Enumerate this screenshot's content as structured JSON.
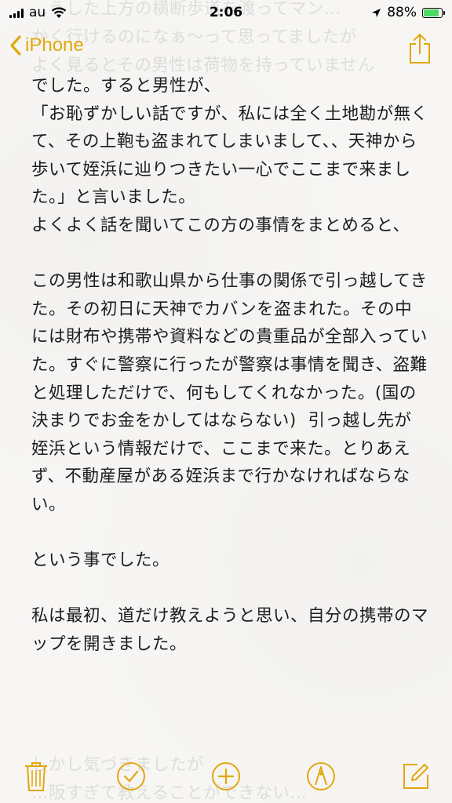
{
  "status_bar": {
    "carrier": "au",
    "time": "2:06",
    "battery_percent": "88%",
    "battery_level": 0.88
  },
  "nav": {
    "back_label": "iPhone"
  },
  "note": {
    "faded_top_1": "…うした上方の横断歩道を渡ってマン…",
    "faded_top_2": "かく行けるのになぁ〜って思ってましたが",
    "faded_top_3": "よく見るとその男性は荷物を持っていません",
    "body": "でした。すると男性が、\n「お恥ずかしい話ですが、私には全く土地勘が無くて、その上鞄も盗まれてしまいまして、、天神から歩いて姪浜に辿りつきたい一心でここまで来ました。」と言いました。\nよくよく話を聞いてこの方の事情をまとめると、\n\nこの男性は和歌山県から仕事の関係で引っ越してきた。その初日に天神でカバンを盗まれた。その中には財布や携帯や資料などの貴重品が全部入っていた。すぐに警察に行ったが警察は事情を聞き、盗難と処理しただけで、何もしてくれなかった。(国の決まりでお金をかしてはならない)  引っ越し先が姪浜という情報だけで、ここまで来た。とりあえず、不動産屋がある姪浜まで行かなければならない。\n\nという事でした。\n\n私は最初、道だけ教えようと思い、自分の携帯のマップを開きました。",
    "faded_bottom_1": "しかし気づきましたが",
    "faded_bottom_2": "…阪すぎて教えることができない…"
  },
  "colors": {
    "accent": "#e2a70e",
    "battery": "#4cd964"
  },
  "toolbar": {
    "icons": [
      "trash-icon",
      "checklist-icon",
      "add-icon",
      "markup-icon",
      "compose-icon"
    ]
  }
}
